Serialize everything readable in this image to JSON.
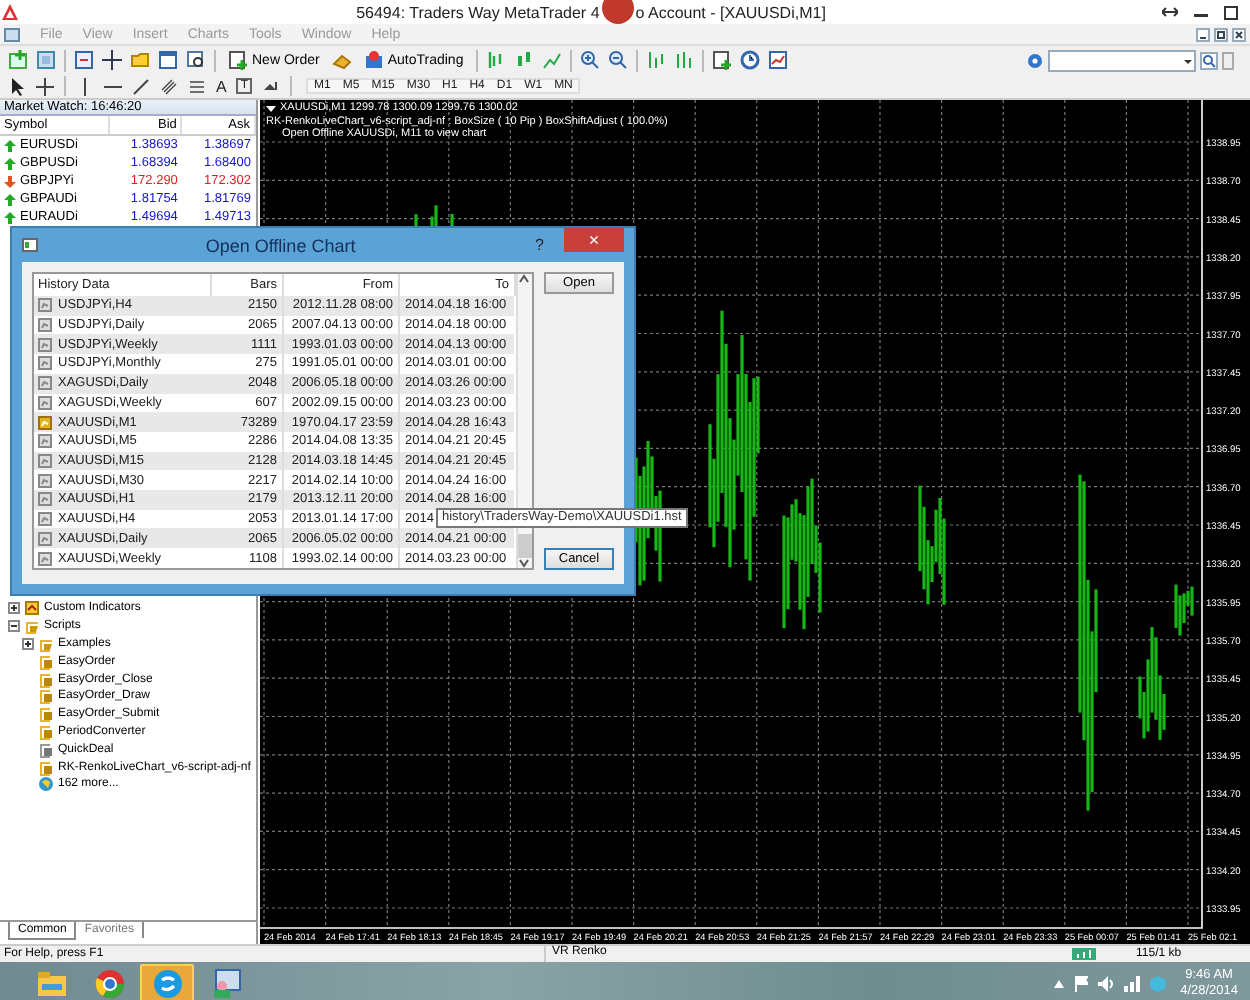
{
  "window": {
    "title_start": "56494: Traders Way MetaTrader 4",
    "title_end": "o Account - [XAUUSDi,M1]"
  },
  "menu": [
    "File",
    "View",
    "Insert",
    "Charts",
    "Tools",
    "Window",
    "Help"
  ],
  "toolbar": {
    "buttons": [
      {
        "kind": "order",
        "label": "New Order"
      },
      {
        "kind": "auto",
        "label": "AutoTrading"
      }
    ]
  },
  "drawing_tools": [
    {
      "kind": "cursor"
    },
    {
      "kind": "crosshair"
    },
    {
      "kind": "vline"
    },
    {
      "kind": "hline"
    },
    {
      "kind": "trendline"
    },
    {
      "kind": "channel"
    },
    {
      "kind": "fibo"
    },
    {
      "kind": "text",
      "label": "A"
    },
    {
      "kind": "label",
      "label": "T"
    },
    {
      "kind": "arrows"
    }
  ],
  "timeframes": [
    "M1",
    "M5",
    "M15",
    "M30",
    "H1",
    "H4",
    "D1",
    "W1",
    "MN"
  ],
  "market_watch": {
    "title": "Market Watch: 16:46:20",
    "columns": [
      "Symbol",
      "Bid",
      "Ask"
    ],
    "rows": [
      {
        "symbol": "EURUSDi",
        "bid": "1.38693",
        "ask": "1.38697",
        "rising": true
      },
      {
        "symbol": "GBPUSDi",
        "bid": "1.68394",
        "ask": "1.68400",
        "rising": true
      },
      {
        "symbol": "GBPJPYi",
        "bid": "172.290",
        "ask": "172.302",
        "rising": false
      },
      {
        "symbol": "GBPAUDi",
        "bid": "1.81754",
        "ask": "1.81769",
        "rising": true
      },
      {
        "symbol": "EURAUDi",
        "bid": "1.49694",
        "ask": "1.49713",
        "rising": true
      }
    ]
  },
  "navigator": {
    "items": [
      {
        "label": "Custom Indicators",
        "kind": "indicator",
        "expanded": false
      },
      {
        "label": "Scripts",
        "kind": "folder",
        "expanded": true,
        "children": [
          {
            "label": "Examples",
            "kind": "folder",
            "expanded": false
          },
          {
            "label": "EasyOrder",
            "kind": "script"
          },
          {
            "label": "EasyOrder_Close",
            "kind": "script"
          },
          {
            "label": "EasyOrder_Draw",
            "kind": "script"
          },
          {
            "label": "EasyOrder_Submit",
            "kind": "script"
          },
          {
            "label": "PeriodConverter",
            "kind": "script"
          },
          {
            "label": "QuickDeal",
            "kind": "grey"
          },
          {
            "label": "RK-RenkoLiveChart_v6-script-adj-nf",
            "kind": "script"
          },
          {
            "label": "162 more...",
            "kind": "globe"
          }
        ]
      }
    ],
    "tabs": [
      {
        "label": "Common",
        "selected": true
      },
      {
        "label": "Favorites",
        "selected": false
      }
    ]
  },
  "chart": {
    "symbol_line": "XAUUSDi,M1  1299.78 1300.09 1299.76 1300.02",
    "indicator_line": "RK-RenkoLiveChart_v6-script_adj-nf : BoxSize ( 10 Pip ) BoxShiftAdjust ( 100.0%)",
    "note": "Open Offline XAUUSDi, M11 to view chart",
    "price_labels": [
      "1338.95",
      "1338.70",
      "1338.45",
      "1338.20",
      "1337.95",
      "1337.70",
      "1337.45",
      "1337.20",
      "1336.95",
      "1336.70",
      "1336.45",
      "1336.20",
      "1335.95",
      "1335.70",
      "1335.45",
      "1335.20",
      "1334.95",
      "1334.70",
      "1334.45",
      "1334.20",
      "1333.95"
    ],
    "time_labels": [
      "24 Feb 2014",
      "24 Feb 17:41",
      "24 Feb 18:13",
      "24 Feb 18:45",
      "24 Feb 19:17",
      "24 Feb 19:49",
      "24 Feb 20:21",
      "24 Feb 20:53",
      "24 Feb 21:25",
      "24 Feb 21:57",
      "24 Feb 22:29",
      "24 Feb 23:01",
      "24 Feb 23:33",
      "25 Feb 00:07",
      "25 Feb 01:41",
      "25 Feb 02:1"
    ]
  },
  "dialog": {
    "title": "Open Offline Chart",
    "help": "?",
    "close": "×",
    "columns": [
      "History Data",
      "Bars",
      "From",
      "To"
    ],
    "rows": [
      {
        "name": "USDJPYi,H4",
        "bars": "2150",
        "from": "2012.11.28 08:00",
        "to": "2014.04.18 16:00",
        "selected": false
      },
      {
        "name": "USDJPYi,Daily",
        "bars": "2065",
        "from": "2007.04.13 00:00",
        "to": "2014.04.18 00:00",
        "selected": false
      },
      {
        "name": "USDJPYi,Weekly",
        "bars": "1111",
        "from": "1993.01.03 00:00",
        "to": "2014.04.13 00:00",
        "selected": false
      },
      {
        "name": "USDJPYi,Monthly",
        "bars": "275",
        "from": "1991.05.01 00:00",
        "to": "2014.03.01 00:00",
        "selected": false
      },
      {
        "name": "XAGUSDi,Daily",
        "bars": "2048",
        "from": "2006.05.18 00:00",
        "to": "2014.03.26 00:00",
        "selected": false
      },
      {
        "name": "XAGUSDi,Weekly",
        "bars": "607",
        "from": "2002.09.15 00:00",
        "to": "2014.03.23 00:00",
        "selected": false
      },
      {
        "name": "XAUUSDi,M1",
        "bars": "73289",
        "from": "1970.04.17 23:59",
        "to": "2014.04.28 16:43",
        "selected": true
      },
      {
        "name": "XAUUSDi,M5",
        "bars": "2286",
        "from": "2014.04.08 13:35",
        "to": "2014.04.21 20:45",
        "selected": false
      },
      {
        "name": "XAUUSDi,M15",
        "bars": "2128",
        "from": "2014.03.18 14:45",
        "to": "2014.04.21 20:45",
        "selected": false
      },
      {
        "name": "XAUUSDi,M30",
        "bars": "2217",
        "from": "2014.02.14 10:00",
        "to": "2014.04.24 16:00",
        "selected": false
      },
      {
        "name": "XAUUSDi,H1",
        "bars": "2179",
        "from": "2013.12.11 20:00",
        "to": "2014.04.28 16:00",
        "selected": false
      },
      {
        "name": "XAUUSDi,H4",
        "bars": "2053",
        "from": "2013.01.14 17:00",
        "to": "2014",
        "selected": false
      },
      {
        "name": "XAUUSDi,Daily",
        "bars": "2065",
        "from": "2006.05.02 00:00",
        "to": "2014.04.21 00:00",
        "selected": false
      },
      {
        "name": "XAUUSDi,Weekly",
        "bars": "1108",
        "from": "1993.02.14 00:00",
        "to": "2014.03.23 00:00",
        "selected": false
      }
    ],
    "buttons": [
      "Open",
      "Cancel"
    ],
    "tooltip": "history\\TradersWay-Demo\\XAUUSDi1.hst"
  },
  "status_bar": {
    "help": "For Help, press F1",
    "profile": "VR Renko",
    "traffic": "115/1 kb"
  },
  "taskbar": {
    "apps": [
      {
        "kind": "explorer",
        "active": false
      },
      {
        "kind": "browser",
        "active": false
      },
      {
        "kind": "chat",
        "active": true
      },
      {
        "kind": "admin",
        "active": false
      }
    ],
    "time": "9:46 AM",
    "date": "4/28/2014"
  }
}
